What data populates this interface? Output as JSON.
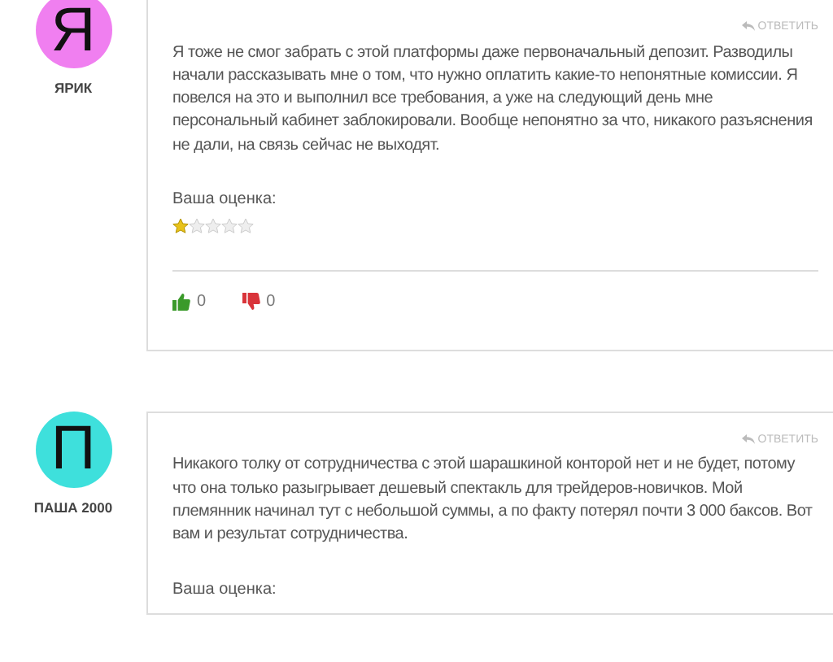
{
  "comments": [
    {
      "avatar_letter": "Я",
      "color": "#f07ff0",
      "author": "ЯРИК",
      "reply": "ОТВЕТИТЬ",
      "text": "Я тоже не смог забрать с этой платформы даже первоначальный депозит. Разводилы начали рассказывать мне о том, что нужно оплатить какие-то непонятные комиссии. Я повелся на это и выполнил все требования, а уже на следующий день мне персональный кабинет заблокировали. Вообще непонятно за что, никакого разъяснения не дали, на связь сейчас не выходят.",
      "rating_label": "Ваша оценка:",
      "stars": 1,
      "likes": "0",
      "dislikes": "0"
    },
    {
      "avatar_letter": "П",
      "color": "#3ee0dc",
      "author": "ПАША 2000",
      "reply": "ОТВЕТИТЬ",
      "text": "Никакого толку от сотрудничества с этой шарашкиной конторой нет и не будет, потому что она только разыгрывает дешевый спектакль для трейдеров-новичков. Мой племянник начинал тут с небольшой суммы, а по факту потерял почти 3 000 баксов. Вот вам и результат сотрудничества.",
      "rating_label": "Ваша оценка:"
    }
  ]
}
